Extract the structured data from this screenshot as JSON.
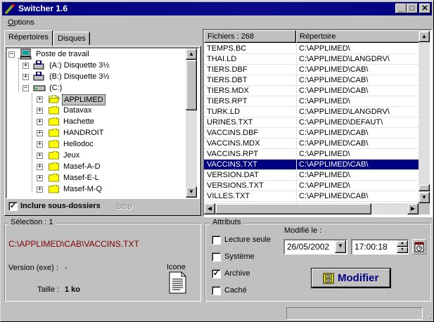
{
  "window": {
    "title": "Switcher 1.6",
    "min_glyph": "_",
    "max_glyph": "□",
    "close_glyph": "✕"
  },
  "menu": {
    "options_prefix": "O",
    "options_rest": "ptions"
  },
  "tabs": [
    {
      "label": "Répertoires"
    },
    {
      "label": "Disques"
    }
  ],
  "tree": {
    "root": "Poste de travail",
    "drives": [
      "(A:)  Disquette 3½",
      "(B:)  Disquette 3½",
      "(C:)"
    ],
    "folders": [
      "APPLIMED",
      "Datavax",
      "Hachette",
      "HANDROIT",
      "Hellodoc",
      "Jeux",
      "Masef-A-D",
      "Masef-E-L",
      "Masef-M-Q"
    ],
    "selected": "APPLIMED",
    "include_label": "Inclure sous-dossiers",
    "include_checked": true,
    "stop_label": "Stop"
  },
  "list": {
    "header_files": "Fichiers : 268",
    "header_dir": "Répertoire",
    "rows": [
      [
        "TEMPS.BC",
        "C:\\APPLIMED\\"
      ],
      [
        "THAI.LD",
        "C:\\APPLIMED\\LANGDRV\\"
      ],
      [
        "TIERS.DBF",
        "C:\\APPLIMED\\CAB\\"
      ],
      [
        "TIERS.DBT",
        "C:\\APPLIMED\\CAB\\"
      ],
      [
        "TIERS.MDX",
        "C:\\APPLIMED\\CAB\\"
      ],
      [
        "TIERS.RPT",
        "C:\\APPLIMED\\"
      ],
      [
        "TURK.LD",
        "C:\\APPLIMED\\LANGDRV\\"
      ],
      [
        "URINES.TXT",
        "C:\\APPLIMED\\DEFAUT\\"
      ],
      [
        "VACCINS.DBF",
        "C:\\APPLIMED\\CAB\\"
      ],
      [
        "VACCINS.MDX",
        "C:\\APPLIMED\\CAB\\"
      ],
      [
        "VACCINS.RPT",
        "C:\\APPLIMED\\"
      ],
      [
        "VACCINS.TXT",
        "C:\\APPLIMED\\CAB\\"
      ],
      [
        "VERSION.DAT",
        "C:\\APPLIMED\\"
      ],
      [
        "VERSIONS.TXT",
        "C:\\APPLIMED\\"
      ],
      [
        "VILLES.TXT",
        "C:\\APPLIMED\\CAB\\"
      ]
    ],
    "selected_index": 11
  },
  "selection": {
    "legend": "Sélection : 1",
    "path": "C:\\APPLIMED\\CAB\\VACCINS.TXT",
    "version_label": "Version (exe) :",
    "version_value": "-",
    "size_label": "Taille :",
    "size_value": "1 ko",
    "icon_label": "Icone"
  },
  "attributes": {
    "legend": "Attributs",
    "items": [
      {
        "label": "Lecture seule",
        "checked": false
      },
      {
        "label": "Système",
        "checked": false
      },
      {
        "label": "Archive",
        "checked": true
      },
      {
        "label": "Caché",
        "checked": false
      }
    ],
    "modified_label": "Modifié le :",
    "date": "26/05/2002",
    "time": "17:00:18",
    "modify_button": "Modifier"
  },
  "colors": {
    "selection_path": "#800000",
    "highlight": "#000080",
    "title": "#000080"
  }
}
